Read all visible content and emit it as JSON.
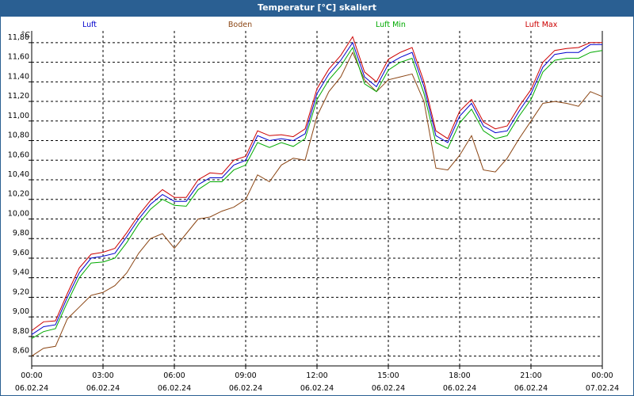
{
  "window": {
    "title": "Temperatur [°C] skaliert"
  },
  "chart_data": {
    "type": "line",
    "title": "Temperatur [°C] skaliert",
    "ylabel": "°C",
    "ylim": [
      8.5,
      11.92
    ],
    "y_ticks": [
      "8,60",
      "8,80",
      "9,00",
      "9,20",
      "9,40",
      "9,60",
      "9,80",
      "10,00",
      "10,20",
      "10,40",
      "10,60",
      "10,80",
      "11,00",
      "11,20",
      "11,40",
      "11,60",
      "11,80"
    ],
    "x_range_hours": [
      0,
      24
    ],
    "x_ticks": [
      {
        "time": "00:00",
        "date": "06.02.24"
      },
      {
        "time": "03:00",
        "date": "06.02.24"
      },
      {
        "time": "06:00",
        "date": "06.02.24"
      },
      {
        "time": "09:00",
        "date": "06.02.24"
      },
      {
        "time": "12:00",
        "date": "06.02.24"
      },
      {
        "time": "15:00",
        "date": "06.02.24"
      },
      {
        "time": "18:00",
        "date": "06.02.24"
      },
      {
        "time": "21:00",
        "date": "06.02.24"
      },
      {
        "time": "00:00",
        "date": "07.02.24"
      }
    ],
    "grid": true,
    "legend_position": "top",
    "series": [
      {
        "name": "Luft",
        "color": "#0000cc",
        "x": [
          0,
          0.5,
          1,
          1.5,
          2,
          2.5,
          3,
          3.5,
          4,
          4.5,
          5,
          5.5,
          6,
          6.5,
          7,
          7.5,
          8,
          8.5,
          9,
          9.5,
          10,
          10.5,
          11,
          11.5,
          12,
          12.5,
          13,
          13.5,
          14,
          14.5,
          15,
          15.5,
          16,
          16.5,
          17,
          17.5,
          18,
          18.5,
          19,
          19.5,
          20,
          20.5,
          21,
          21.5,
          22,
          22.5,
          23,
          23.5,
          24
        ],
        "y": [
          8.82,
          8.9,
          8.92,
          9.2,
          9.45,
          9.6,
          9.62,
          9.65,
          9.82,
          10.0,
          10.15,
          10.25,
          10.18,
          10.18,
          10.35,
          10.42,
          10.42,
          10.55,
          10.6,
          10.85,
          10.8,
          10.82,
          10.8,
          10.87,
          11.28,
          11.48,
          11.62,
          11.8,
          11.45,
          11.35,
          11.58,
          11.65,
          11.7,
          11.35,
          10.85,
          10.78,
          11.05,
          11.18,
          10.95,
          10.88,
          10.9,
          11.1,
          11.28,
          11.55,
          11.68,
          11.7,
          11.7,
          11.78,
          11.78
        ]
      },
      {
        "name": "Boden",
        "color": "#8b4513",
        "x": [
          0,
          0.5,
          1,
          1.5,
          2,
          2.5,
          3,
          3.5,
          4,
          4.5,
          5,
          5.5,
          6,
          6.5,
          7,
          7.5,
          8,
          8.5,
          9,
          9.5,
          10,
          10.5,
          11,
          11.5,
          12,
          12.5,
          13,
          13.5,
          14,
          14.5,
          15,
          15.5,
          16,
          16.5,
          17,
          17.5,
          18,
          18.5,
          19,
          19.5,
          20,
          20.5,
          21,
          21.5,
          22,
          22.5,
          23,
          23.5,
          24
        ],
        "y": [
          8.6,
          8.68,
          8.7,
          8.98,
          9.1,
          9.22,
          9.25,
          9.32,
          9.45,
          9.65,
          9.8,
          9.85,
          9.7,
          9.85,
          10.0,
          10.02,
          10.08,
          10.12,
          10.2,
          10.45,
          10.38,
          10.55,
          10.62,
          10.6,
          11.05,
          11.3,
          11.45,
          11.7,
          11.42,
          11.3,
          11.42,
          11.45,
          11.48,
          11.2,
          10.52,
          10.5,
          10.65,
          10.85,
          10.5,
          10.48,
          10.62,
          10.82,
          11.0,
          11.18,
          11.2,
          11.18,
          11.15,
          11.3,
          11.25
        ]
      },
      {
        "name": "Luft Min",
        "color": "#00aa00",
        "x": [
          0,
          0.5,
          1,
          1.5,
          2,
          2.5,
          3,
          3.5,
          4,
          4.5,
          5,
          5.5,
          6,
          6.5,
          7,
          7.5,
          8,
          8.5,
          9,
          9.5,
          10,
          10.5,
          11,
          11.5,
          12,
          12.5,
          13,
          13.5,
          14,
          14.5,
          15,
          15.5,
          16,
          16.5,
          17,
          17.5,
          18,
          18.5,
          19,
          19.5,
          20,
          20.5,
          21,
          21.5,
          22,
          22.5,
          23,
          23.5,
          24
        ],
        "y": [
          8.78,
          8.85,
          8.88,
          9.15,
          9.4,
          9.55,
          9.56,
          9.6,
          9.76,
          9.95,
          10.1,
          10.2,
          10.14,
          10.13,
          10.3,
          10.38,
          10.38,
          10.5,
          10.55,
          10.78,
          10.73,
          10.78,
          10.74,
          10.82,
          11.22,
          11.42,
          11.56,
          11.75,
          11.38,
          11.3,
          11.52,
          11.6,
          11.64,
          11.28,
          10.78,
          10.72,
          10.98,
          11.12,
          10.9,
          10.82,
          10.85,
          11.05,
          11.22,
          11.5,
          11.62,
          11.64,
          11.64,
          11.7,
          11.72
        ]
      },
      {
        "name": "Luft Max",
        "color": "#cc0000",
        "x": [
          0,
          0.5,
          1,
          1.5,
          2,
          2.5,
          3,
          3.5,
          4,
          4.5,
          5,
          5.5,
          6,
          6.5,
          7,
          7.5,
          8,
          8.5,
          9,
          9.5,
          10,
          10.5,
          11,
          11.5,
          12,
          12.5,
          13,
          13.5,
          14,
          14.5,
          15,
          15.5,
          16,
          16.5,
          17,
          17.5,
          18,
          18.5,
          19,
          19.5,
          20,
          20.5,
          21,
          21.5,
          22,
          22.5,
          23,
          23.5,
          24
        ],
        "y": [
          8.86,
          8.95,
          8.96,
          9.24,
          9.5,
          9.64,
          9.66,
          9.7,
          9.86,
          10.04,
          10.19,
          10.3,
          10.22,
          10.22,
          10.4,
          10.47,
          10.46,
          10.6,
          10.64,
          10.9,
          10.85,
          10.86,
          10.84,
          10.92,
          11.33,
          11.53,
          11.67,
          11.86,
          11.5,
          11.4,
          11.63,
          11.7,
          11.75,
          11.4,
          10.9,
          10.82,
          11.1,
          11.22,
          10.99,
          10.92,
          10.95,
          11.15,
          11.32,
          11.6,
          11.72,
          11.74,
          11.75,
          11.8,
          11.8
        ]
      }
    ]
  }
}
